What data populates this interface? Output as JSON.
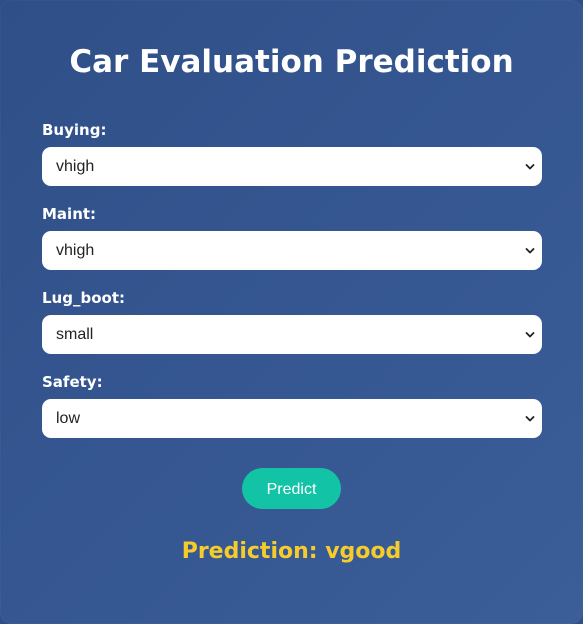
{
  "title": "Car Evaluation Prediction",
  "fields": [
    {
      "label": "Buying:",
      "value": "vhigh"
    },
    {
      "label": "Maint:",
      "value": "vhigh"
    },
    {
      "label": "Lug_boot:",
      "value": "small"
    },
    {
      "label": "Safety:",
      "value": "low"
    }
  ],
  "predict_button": "Predict",
  "prediction": "Prediction: vgood",
  "colors": {
    "background": "#34558f",
    "button": "#12c3a6",
    "prediction_text": "#f6cc2a"
  },
  "icons": {
    "select_arrow": "chevron-down-icon"
  }
}
